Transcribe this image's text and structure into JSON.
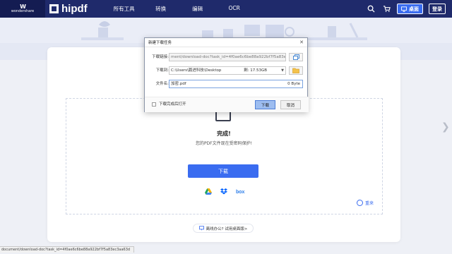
{
  "nav": {
    "brand_small": "wondershare",
    "brand_name": "hipdf",
    "menu": [
      "所有工具",
      "转换",
      "编辑",
      "OCR"
    ],
    "desktop_button": "桌面",
    "login_button": "登录"
  },
  "main": {
    "done_title": "完成!",
    "done_subtitle": "您的PDF文件现在受密码保护!",
    "download_button": "下载",
    "cloud_box_label": "box",
    "restart_label": "重来",
    "promo_text": "离线办公? 试用桌面版>"
  },
  "dialog": {
    "title": "新建下载任务",
    "link_label": "下载链接:",
    "link_value": "ment/download-doc?task_id=4f0ae6c6be88a922bf7f5a83ec3aa63d",
    "save_label": "下载到:",
    "save_path": "C:\\Users\\聂进科技\\Desktop",
    "free_space": "剩: 17.53GB",
    "filename_label": "文件名:",
    "filename_value": "加密.pdf",
    "file_size": "0 Byte",
    "open_after_label": "下载完成后打开",
    "download_button": "下载",
    "cancel_button": "取消"
  },
  "status_bar": {
    "url": "document/download-doc?task_id=4f0ae6c6be88a922bf7f5a83ec3aa63d"
  },
  "colors": {
    "nav_bg": "#1f2a6b",
    "accent": "#3a6cf0",
    "success": "#1aa55a"
  }
}
